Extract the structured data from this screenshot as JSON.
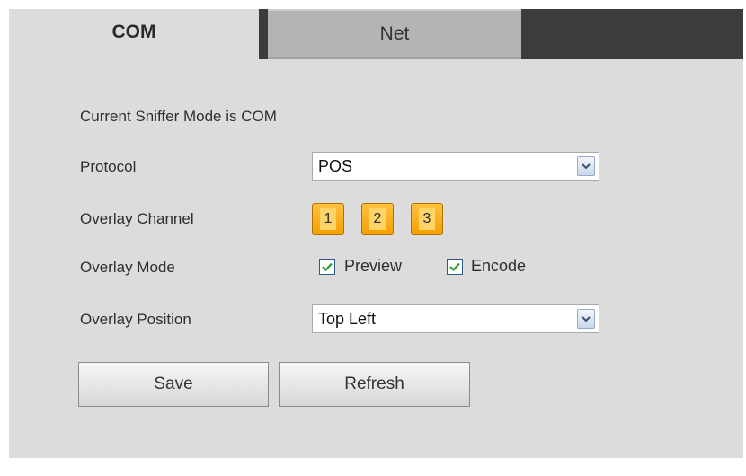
{
  "tabs": {
    "com": "COM",
    "net": "Net"
  },
  "status": {
    "mode_text": "Current Sniffer Mode is COM"
  },
  "form": {
    "protocol": {
      "label": "Protocol",
      "value": "POS"
    },
    "overlay_channel": {
      "label": "Overlay Channel",
      "channels": [
        "1",
        "2",
        "3"
      ]
    },
    "overlay_mode": {
      "label": "Overlay Mode",
      "preview_label": "Preview",
      "preview_checked": true,
      "encode_label": "Encode",
      "encode_checked": true
    },
    "overlay_position": {
      "label": "Overlay Position",
      "value": "Top Left"
    }
  },
  "buttons": {
    "save": "Save",
    "refresh": "Refresh"
  },
  "icons": {
    "dropdown": "chevron-down-icon",
    "checkbox": "checkmark-icon"
  },
  "colors": {
    "panel_bg": "#dcdcdc",
    "tabbar_bg": "#3c3c3c",
    "channel_accent": "#f4a000",
    "checkmark": "#2e9b2e"
  }
}
